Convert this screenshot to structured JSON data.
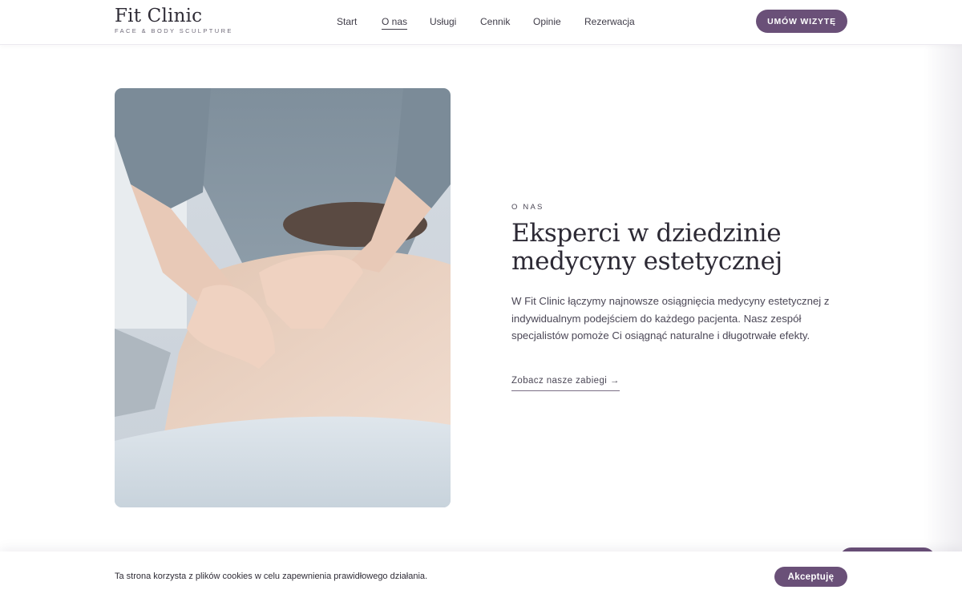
{
  "header": {
    "logo_title": "Fit Clinic",
    "logo_tagline": "FACE & BODY SCULPTURE",
    "nav": [
      {
        "label": "Start",
        "active": false
      },
      {
        "label": "O nas",
        "active": true
      },
      {
        "label": "Usługi",
        "active": false
      },
      {
        "label": "Cennik",
        "active": false
      },
      {
        "label": "Opinie",
        "active": false
      },
      {
        "label": "Rezerwacja",
        "active": false
      }
    ],
    "cta_label": "UMÓW WIZYTĘ"
  },
  "about": {
    "eyebrow": "O NAS",
    "heading": "Eksperci w dziedzinie medycyny estetycznej",
    "body": "W Fit Clinic łączymy najnowsze osiągnięcia medycyny estetycznej z indywidualnym podejściem do każdego pacjenta. Nasz zespół specjalistów pomoże Ci osiągnąć naturalne i długotrwałe efekty.",
    "link_label": "Zobacz nasze zabiegi →",
    "image_icon": "massage-photo"
  },
  "cookie": {
    "text": "Ta strona korzysta z plików cookies w celu zapewnienia prawidłowego działania.",
    "accept_label": "Akceptuję"
  },
  "colors": {
    "accent": "#6a5078",
    "text_dark": "#2c2934",
    "text_body": "#4b4756",
    "background": "#ffffff"
  }
}
